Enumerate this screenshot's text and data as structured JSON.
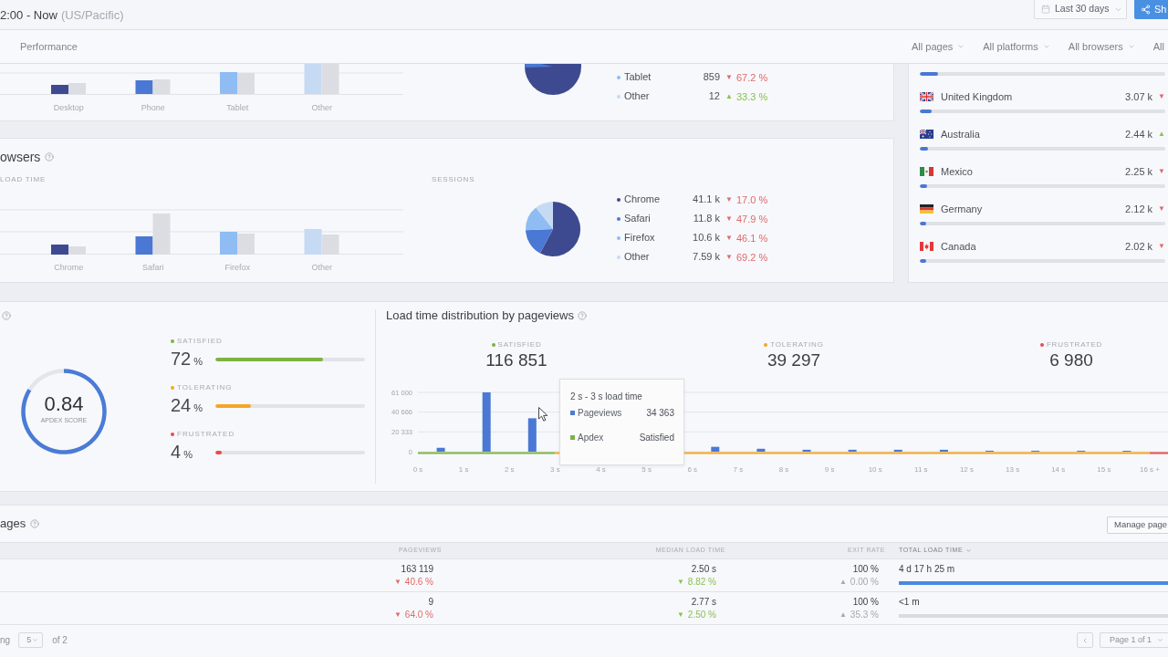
{
  "header": {
    "time_range": "2:00 - Now",
    "timezone": "(US/Pacific)",
    "date_range": "Last 30 days",
    "share": "Sh"
  },
  "filter_bar": {
    "tab": "Performance",
    "filters": [
      "All pages",
      "All platforms",
      "All browsers",
      "All"
    ]
  },
  "platforms": {
    "x_labels": [
      "Desktop",
      "Phone",
      "Tablet",
      "Other"
    ],
    "legend": [
      {
        "label": "Tablet",
        "color": "#8fbcf2",
        "value": "859",
        "change": {
          "arrow": "▼",
          "text": "67.2 %",
          "color": "#e06a6a"
        }
      },
      {
        "label": "Other",
        "color": "#c6daf4",
        "value": "12",
        "change": {
          "arrow": "▲",
          "text": "33.3 %",
          "color": "#8cc152"
        }
      }
    ]
  },
  "browsers": {
    "title": "owsers",
    "load_time": {
      "label": "LOAD TIME",
      "x_labels": [
        "Chrome",
        "Safari",
        "Firefox",
        "Other"
      ]
    },
    "sessions": {
      "label": "SESSIONS",
      "chart_data": {
        "type": "pie",
        "categories": [
          "Chrome",
          "Safari",
          "Firefox",
          "Other"
        ],
        "values": [
          57.8,
          16.6,
          14.9,
          10.7
        ]
      },
      "legend": [
        {
          "color": "#3d4a8f",
          "value": "41.1 k",
          "change": {
            "arrow": "▼",
            "text": "17.0 %",
            "color": "#e06a6a"
          }
        },
        {
          "color": "#4a78d4",
          "value": "11.8 k",
          "change": {
            "arrow": "▼",
            "text": "47.9 %",
            "color": "#e06a6a"
          }
        },
        {
          "color": "#8fbcf2",
          "value": "10.6 k",
          "change": {
            "arrow": "▼",
            "text": "46.1 %",
            "color": "#e06a6a"
          }
        },
        {
          "color": "#c6daf4",
          "value": "7.59 k",
          "change": {
            "arrow": "▼",
            "text": "69.2 %",
            "color": "#e06a6a"
          }
        }
      ]
    }
  },
  "countries": [
    {
      "level": 0.075
    },
    {
      "name": "United Kingdom",
      "value": "3.07 k",
      "change": {
        "arrow": "▼",
        "color": "#e06a6a"
      },
      "level": 0.05
    },
    {
      "name": "Australia",
      "value": "2.44 k",
      "change": {
        "arrow": "▲",
        "color": "#8cc152"
      },
      "level": 0.035
    },
    {
      "name": "Mexico",
      "value": "2.25 k",
      "change": {
        "arrow": "▼",
        "color": "#e06a6a"
      },
      "level": 0.03
    },
    {
      "name": "Germany",
      "value": "2.12 k",
      "change": {
        "arrow": "▼",
        "color": "#e06a6a"
      },
      "level": 0.027
    },
    {
      "name": "Canada",
      "value": "2.02 k",
      "change": {
        "arrow": "▼",
        "color": "#e06a6a"
      },
      "level": 0.026
    }
  ],
  "apdex": {
    "score": "0.84",
    "caption": "APDEX SCORE",
    "chart_data": {
      "type": "donut",
      "values": [
        84,
        16
      ]
    },
    "groups": [
      {
        "label": "SATISFIED",
        "color": "#7cb342",
        "value": "72",
        "unit": "%",
        "level": 0.72
      },
      {
        "label": "TOLERATING",
        "color": "#f5a623",
        "value": "24",
        "unit": "%",
        "level": 0.24
      },
      {
        "label": "FRUSTRATED",
        "color": "#e94b4b",
        "value": "4",
        "unit": "%",
        "level": 0.04
      }
    ]
  },
  "distribution": {
    "title": "Load time distribution by pageviews",
    "stats": [
      {
        "label": "SATISFIED",
        "color": "#7cb342",
        "value": "116 851"
      },
      {
        "label": "TOLERATING",
        "color": "#f5a623",
        "value": "39 297"
      },
      {
        "label": "FRUSTRATED",
        "color": "#e94b4b",
        "value": "6 980"
      }
    ],
    "chart_data": {
      "type": "bar",
      "x": [
        0.5,
        1.5,
        2.5,
        6.5,
        7.5,
        8.5,
        9.5,
        10.5,
        11.5,
        12.5,
        13.5,
        14.5,
        15.5
      ],
      "values": [
        4000,
        61000,
        34363,
        5000,
        3000,
        2000,
        2000,
        2000,
        2000,
        1000,
        1000,
        1000,
        500
      ],
      "xlim": [
        0,
        16.4
      ],
      "ylim": [
        0,
        61000
      ],
      "xticks": [
        {
          "value": 0,
          "label": "0 s"
        },
        {
          "value": 1,
          "label": "1 s"
        },
        {
          "value": 2,
          "label": "2 s"
        },
        {
          "value": 3,
          "label": "3 s"
        },
        {
          "value": 4,
          "label": "4 s"
        },
        {
          "value": 5,
          "label": "5 s"
        },
        {
          "value": 6,
          "label": "6 s"
        },
        {
          "value": 7,
          "label": "7 s"
        },
        {
          "value": 8,
          "label": "8 s"
        },
        {
          "value": 9,
          "label": "9 s"
        },
        {
          "value": 10,
          "label": "10 s"
        },
        {
          "value": 11,
          "label": "11 s"
        },
        {
          "value": 12,
          "label": "12 s"
        },
        {
          "value": 13,
          "label": "13 s"
        },
        {
          "value": 14,
          "label": "14 s"
        },
        {
          "value": 15,
          "label": "15 s"
        },
        {
          "value": 16,
          "label": "16 s +"
        }
      ],
      "yticks": [
        0,
        {
          "value": 20333,
          "label": "20 333"
        },
        {
          "value": 40666,
          "label": "40 666"
        },
        {
          "value": 61000,
          "label": "61 000"
        }
      ]
    },
    "tooltip": {
      "title": "2 s - 3 s load time",
      "rows": [
        {
          "color": "#4a7bd6",
          "label": "Pageviews",
          "value": "34 363"
        },
        {
          "color": "#7cb342",
          "label": "Apdex",
          "value": "Satisfied"
        }
      ]
    }
  },
  "pages": {
    "title": "ages",
    "manage_button": "Manage page",
    "columns": [
      {
        "label": "PAGEVIEWS",
        "sorted": false
      },
      {
        "label": "MEDIAN LOAD TIME",
        "sorted": false
      },
      {
        "label": "EXIT RATE",
        "sorted": false
      },
      {
        "label": "TOTAL LOAD TIME",
        "sorted": true
      }
    ],
    "rows": [
      {
        "pageviews": {
          "value": "163 119",
          "change": {
            "arrow": "▼",
            "text": "40.6 %",
            "color": "#e06a6a"
          }
        },
        "median_load_time": {
          "value": "2.50 s",
          "change": {
            "arrow": "▼",
            "text": "8.82 %",
            "color": "#8cc152"
          }
        },
        "exit_rate": {
          "value": "100 %",
          "change": {
            "arrow": "▲",
            "text": "0.00 %",
            "color": "#a4a8b1"
          }
        },
        "total_load_time": {
          "value": "4 d 17 h 25 m",
          "level": 1
        }
      },
      {
        "pageviews": {
          "value": "9",
          "change": {
            "arrow": "▼",
            "text": "64.0 %",
            "color": "#e06a6a"
          }
        },
        "median_load_time": {
          "value": "2.77 s",
          "change": {
            "arrow": "▼",
            "text": "2.50 %",
            "color": "#8cc152"
          }
        },
        "exit_rate": {
          "value": "100 %",
          "change": {
            "arrow": "▲",
            "text": "35.3 %",
            "color": "#a4a8b1"
          }
        },
        "total_load_time": {
          "value": "<1 m",
          "level": 0
        }
      }
    ],
    "footer": {
      "showing": "ng",
      "page_size": "5",
      "of_pages": "of 2",
      "page_select": "Page 1 of 1"
    }
  }
}
